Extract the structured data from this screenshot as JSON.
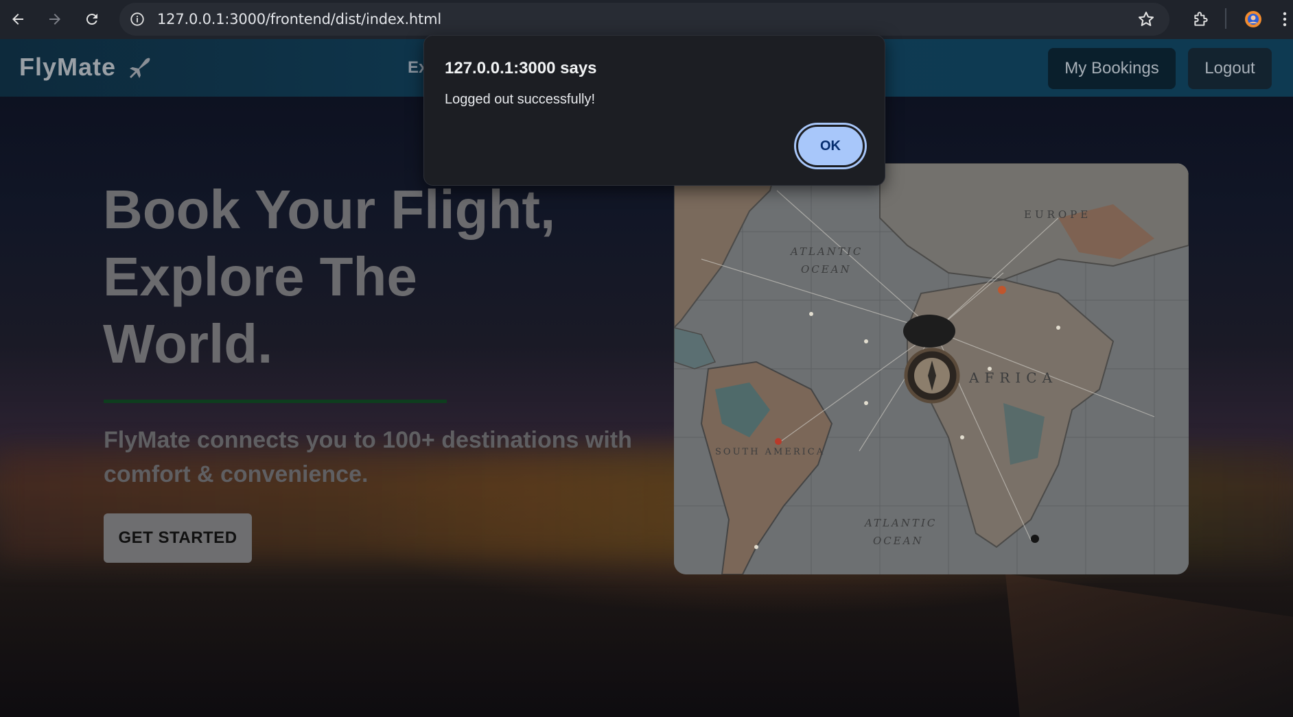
{
  "browser": {
    "url": "127.0.0.1:3000/frontend/dist/index.html",
    "icons": {
      "back": "arrow-left-icon",
      "forward": "arrow-right-icon",
      "reload": "reload-icon",
      "site_info": "info-icon",
      "bookmark": "star-icon",
      "extensions": "puzzle-icon",
      "profile": "profile-avatar-icon",
      "menu": "kebab-menu-icon"
    }
  },
  "navbar": {
    "brand": "FlyMate",
    "explore_partial": "Ex",
    "my_bookings": "My Bookings",
    "logout": "Logout"
  },
  "hero": {
    "title_line1": "Book Your Flight,",
    "title_line2": "Explore The",
    "title_line3": "World.",
    "subtitle_line1": "FlyMate connects you to 100+ destinations with",
    "subtitle_line2": "comfort & convenience.",
    "cta": "GET STARTED"
  },
  "map": {
    "label_atlantic_top": "ATLANTIC",
    "label_ocean_top": "OCEAN",
    "label_atlantic_bottom": "ATLANTIC",
    "label_ocean_bottom": "OCEAN",
    "label_south_america": "SOUTH AMERICA",
    "label_africa": "AFRICA",
    "label_europe": "EUROPE"
  },
  "dialog": {
    "title": "127.0.0.1:3000 says",
    "message": "Logged out successfully!",
    "ok": "OK"
  },
  "colors": {
    "accent_dialog_button": "#a8c7fa",
    "navbar": "#0f3a52",
    "hero_divider": "#0e3d1e"
  }
}
